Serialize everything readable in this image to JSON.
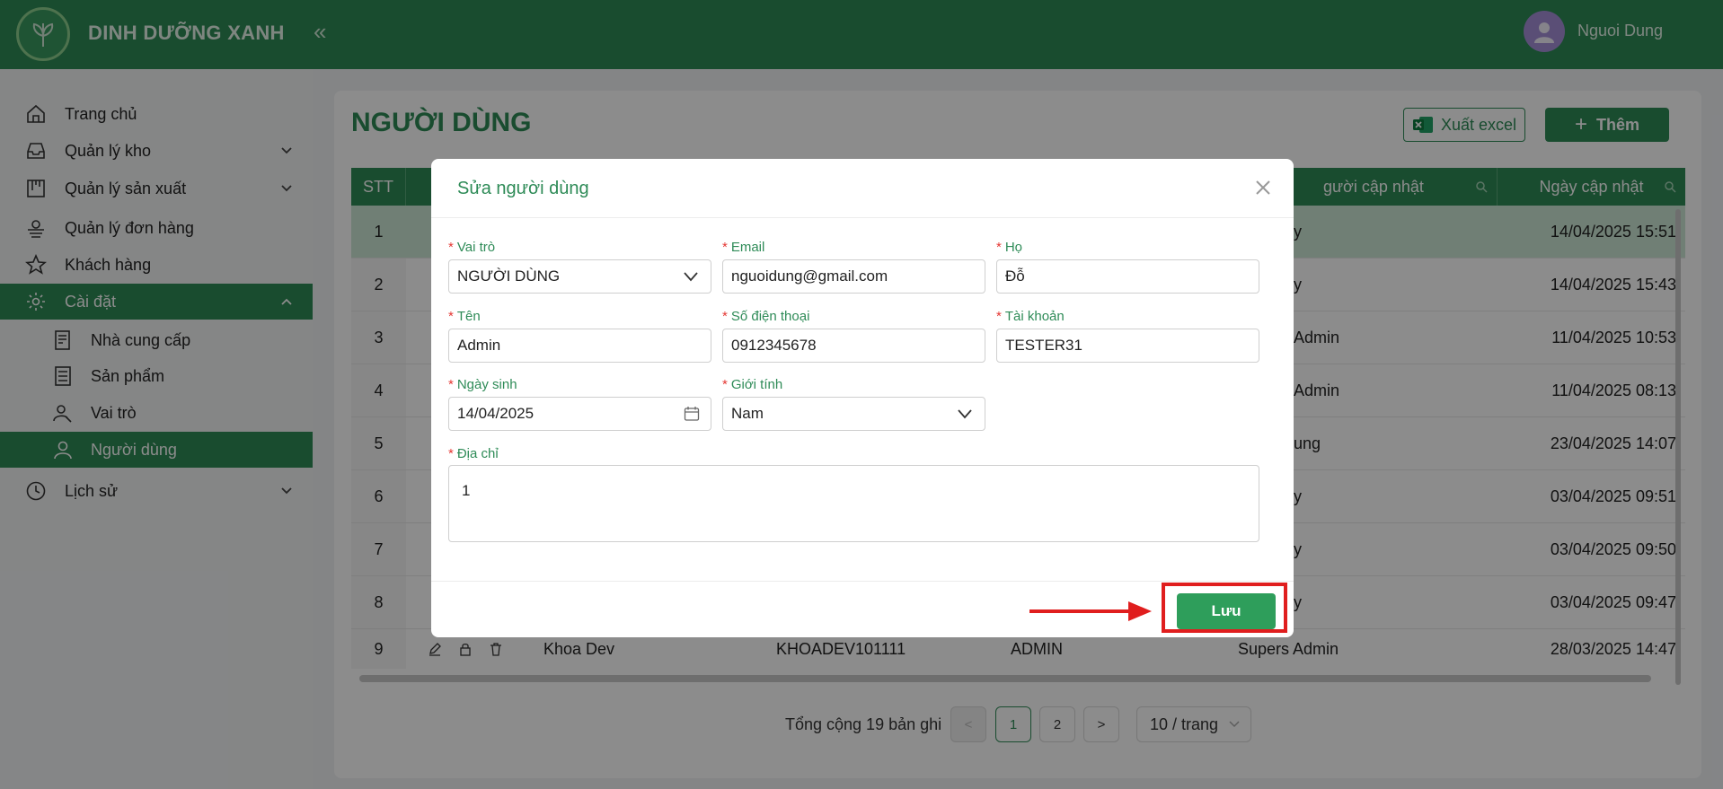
{
  "header": {
    "brand": "DINH DƯỠNG XANH",
    "collapse_icon": "double-chevron-left-icon",
    "user_name": "Nguoi Dung"
  },
  "sidebar": {
    "items": [
      {
        "label": "Trang chủ",
        "icon": "home-icon"
      },
      {
        "label": "Quản lý kho",
        "icon": "inbox-icon",
        "chevron": "⌄"
      },
      {
        "label": "Quản lý sản xuất",
        "icon": "factory-icon",
        "chevron": "⌄"
      },
      {
        "label": "Quản lý đơn hàng",
        "icon": "order-icon"
      },
      {
        "label": "Khách hàng",
        "icon": "star-icon"
      },
      {
        "label": "Cài đặt",
        "icon": "gear-icon",
        "chevron": "⌃"
      },
      {
        "label": "Nhà cung cấp",
        "icon": "supplier-icon"
      },
      {
        "label": "Sản phẩm",
        "icon": "product-icon"
      },
      {
        "label": "Vai trò",
        "icon": "role-icon"
      },
      {
        "label": "Người dùng",
        "icon": "user-icon"
      },
      {
        "label": "Lịch sử",
        "icon": "history-icon",
        "chevron": "⌄"
      }
    ]
  },
  "page": {
    "title": "NGƯỜI DÙNG",
    "export_label": "Xuất excel",
    "add_label": "Thêm"
  },
  "table": {
    "headers": {
      "stt": "STT",
      "updated_by": "gười cập nhật",
      "updated_at": "Ngày cập nhật"
    },
    "rows": [
      {
        "stt": "1",
        "updated_by": "y",
        "updated_at": "14/04/2025 15:51"
      },
      {
        "stt": "2",
        "updated_by": "y",
        "updated_at": "14/04/2025 15:43"
      },
      {
        "stt": "3",
        "updated_by": "Admin",
        "updated_at": "11/04/2025 10:53"
      },
      {
        "stt": "4",
        "updated_by": "Admin",
        "updated_at": "11/04/2025 08:13"
      },
      {
        "stt": "5",
        "updated_by": "ung",
        "updated_at": "23/04/2025 14:07"
      },
      {
        "stt": "6",
        "updated_by": "y",
        "updated_at": "03/04/2025 09:51"
      },
      {
        "stt": "7",
        "updated_by": "y",
        "updated_at": "03/04/2025 09:50"
      },
      {
        "stt": "8",
        "updated_by": "y",
        "updated_at": "03/04/2025 09:47"
      },
      {
        "stt": "9",
        "name": "Khoa Dev",
        "account": "KHOADEV101111",
        "role": "ADMIN",
        "updated_by": "Supers Admin",
        "updated_at": "28/03/2025 14:47"
      }
    ]
  },
  "pagination": {
    "total": "Tổng cộng 19 bản ghi",
    "prev": "<",
    "pages": [
      "1",
      "2"
    ],
    "next": ">",
    "page_size": "10 / trang"
  },
  "modal": {
    "title": "Sửa người dùng",
    "fields": {
      "role": {
        "label": "Vai trò",
        "value": "NGƯỜI DÙNG"
      },
      "email": {
        "label": "Email",
        "value": "nguoidung@gmail.com"
      },
      "last_name": {
        "label": "Họ",
        "value": "Đỗ"
      },
      "first_name": {
        "label": "Tên",
        "value": "Admin"
      },
      "phone": {
        "label": "Số điện thoại",
        "value": "0912345678"
      },
      "account": {
        "label": "Tài khoản",
        "value": "TESTER31"
      },
      "dob": {
        "label": "Ngày sinh",
        "value": "14/04/2025"
      },
      "gender": {
        "label": "Giới tính",
        "value": "Nam"
      },
      "address": {
        "label": "Địa chỉ",
        "value": "1"
      }
    },
    "required_mark": "*",
    "save_label": "Lưu"
  },
  "colors": {
    "primary": "#2e8b57",
    "highlight": "#e01e1e"
  }
}
